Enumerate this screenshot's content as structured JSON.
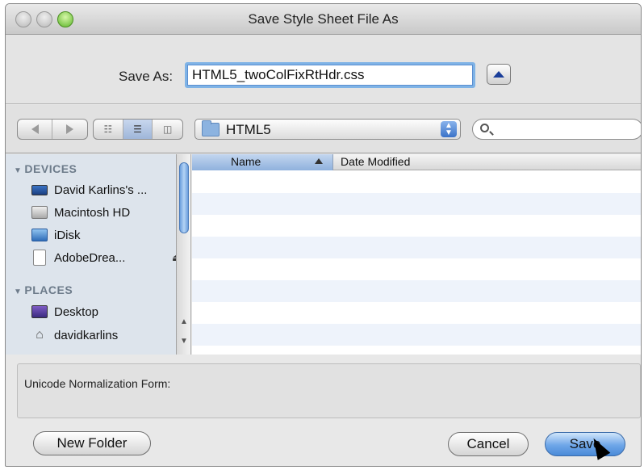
{
  "window": {
    "title": "Save Style Sheet File As"
  },
  "save_as": {
    "label": "Save As:",
    "value": "HTML5_twoColFixRtHdr.css"
  },
  "toolbar": {
    "location": "HTML5",
    "search_placeholder": ""
  },
  "sidebar": {
    "devices_header": "DEVICES",
    "places_header": "PLACES",
    "devices": [
      {
        "label": "David Karlins's ...",
        "icon": "laptop-icon"
      },
      {
        "label": "Macintosh HD",
        "icon": "hard-drive-icon"
      },
      {
        "label": "iDisk",
        "icon": "idisk-icon"
      },
      {
        "label": "AdobeDrea...",
        "icon": "disk-image-icon",
        "ejectable": true
      }
    ],
    "places": [
      {
        "label": "Desktop",
        "icon": "desktop-icon"
      },
      {
        "label": "davidkarlins",
        "icon": "home-icon"
      }
    ]
  },
  "file_list": {
    "columns": [
      "Name",
      "Date Modified"
    ],
    "sort_column": "Name",
    "rows": []
  },
  "unicode_form": {
    "label": "Unicode Normalization Form:"
  },
  "buttons": {
    "new_folder": "New Folder",
    "cancel": "Cancel",
    "save": "Save"
  },
  "colors": {
    "accent": "#4a8ad8",
    "selection_column": "#a9c4e6",
    "sidebar_bg": "#dde4ec"
  }
}
